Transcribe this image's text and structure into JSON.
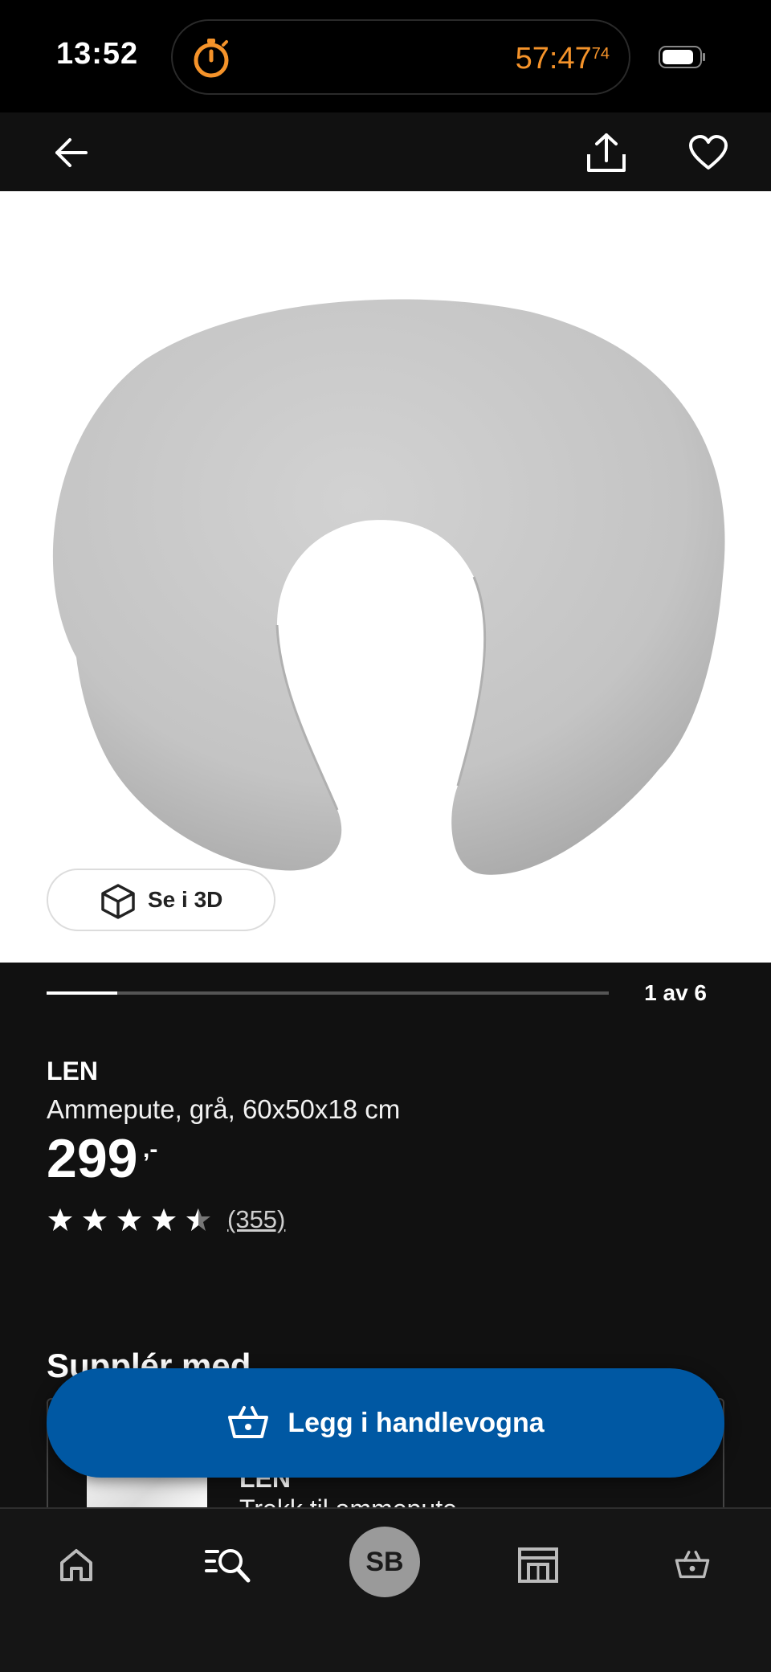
{
  "status_bar": {
    "time": "13:52",
    "timer_main": "57:47",
    "timer_fraction": "74",
    "accent_color": "#f5932a"
  },
  "header": {
    "back_icon": "arrow-left-icon",
    "share_icon": "share-icon",
    "favorite_icon": "heart-icon"
  },
  "gallery": {
    "view_3d_label": "Se i 3D",
    "position_label": "1 av 6",
    "progress_fraction": 0.125
  },
  "product": {
    "name": "LEN",
    "description": "Ammepute, grå, 60x50x18 cm",
    "price": "299",
    "price_suffix": ",-",
    "rating": 4.5,
    "rating_count": "(355)"
  },
  "supplement": {
    "title": "Supplér med",
    "item_name": "LEN",
    "item_desc": "Trekk til ammepute"
  },
  "cta": {
    "label": "Legg i handlevogna",
    "color": "#0058a3"
  },
  "bottom_nav": {
    "avatar_initials": "SB",
    "items": [
      "home-icon",
      "search-icon",
      "avatar",
      "store-icon",
      "cart-icon"
    ]
  }
}
